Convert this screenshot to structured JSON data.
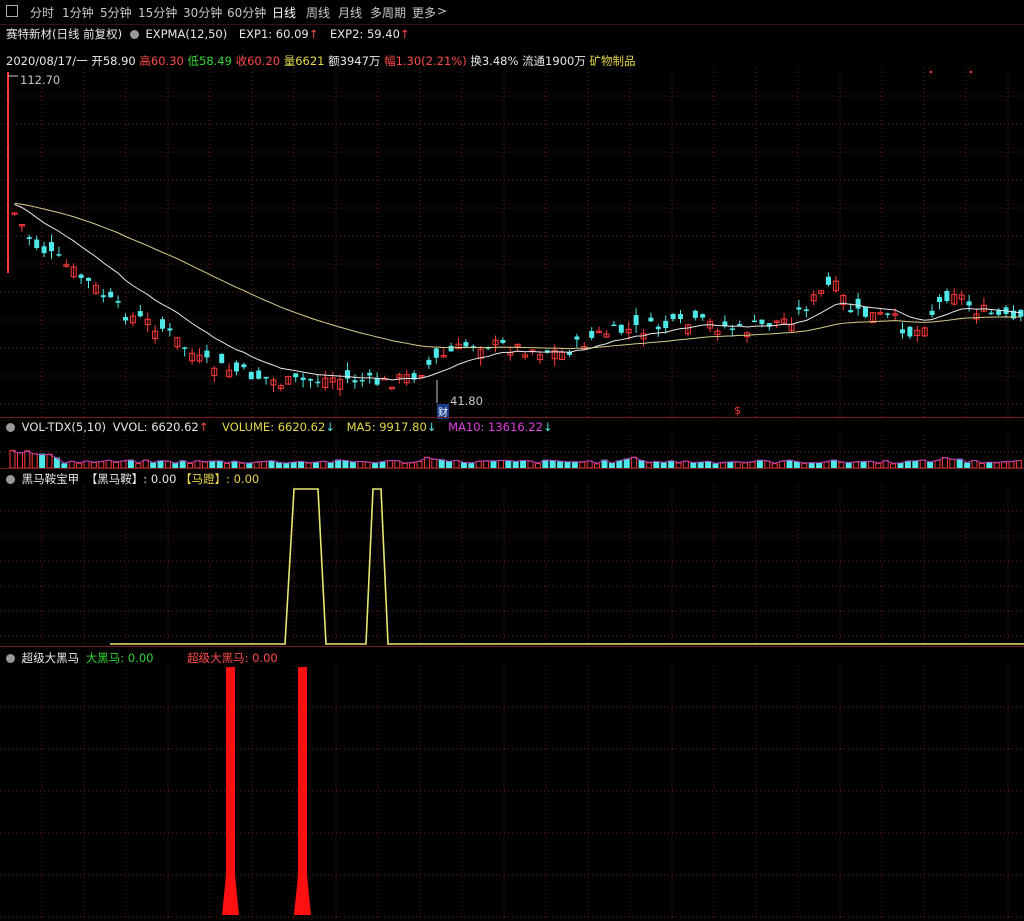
{
  "toolbar": {
    "items": [
      "分时",
      "1分钟",
      "5分钟",
      "15分钟",
      "30分钟",
      "60分钟",
      "日线",
      "周线",
      "月线",
      "多周期",
      "更多"
    ],
    "active": "日线",
    "more_arrow": ">"
  },
  "title_bar": {
    "stock_name": "赛特新材(日线 前复权)",
    "indicator": "EXPMA(12,50)",
    "exp1_label": "EXP1: 60.09",
    "exp1_arrow": "↑",
    "exp2_label": "EXP2: 59.40",
    "exp2_arrow": "↑"
  },
  "quote_bar": {
    "date": "2020/08/17/一",
    "open": "开58.90",
    "high": "高60.30",
    "low": "低58.49",
    "close": "收60.20",
    "volume": "量6621",
    "amount": "额3947万",
    "change": "幅1.30(2.21%)",
    "turnover": "换3.48%",
    "float": "流通1900万",
    "sector": "矿物制品"
  },
  "price_chart": {
    "high_label": "112.70",
    "low_label": "41.80",
    "marker_cai": "财",
    "marker_s": "$"
  },
  "volume_bar": {
    "name": "VOL-TDX(5,10)",
    "vvol": "VVOL: 6620.62",
    "vvol_arrow": "↑",
    "volume": "VOLUME: 6620.62",
    "volume_arrow": "↓",
    "ma5": "MA5: 9917.80",
    "ma5_arrow": "↓",
    "ma10": "MA10: 13616.22",
    "ma10_arrow": "↓"
  },
  "ind1_bar": {
    "name": "黑马鞍宝甲",
    "series1": "【黑马鞍】: 0.00",
    "series2": "【马蹬】: 0.00"
  },
  "ind2_bar": {
    "name": "超级大黑马",
    "series1": "大黑马: 0.00",
    "series2": "超级大黑马: 0.00"
  },
  "colors": {
    "up": "#ff3a3a",
    "down": "#4ee8e8",
    "exp1": "#e8e8e8",
    "exp2": "#d6d08a",
    "ma10": "#b040c0",
    "signal": "#e8e870",
    "spike": "#ff1010",
    "grid": "#7a1b1b"
  }
}
